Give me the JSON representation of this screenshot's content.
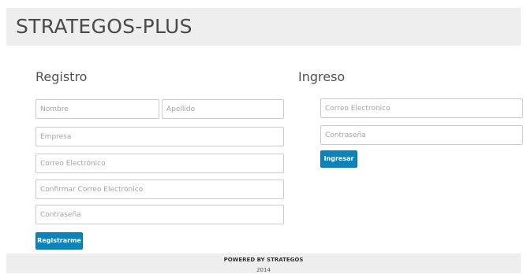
{
  "header": {
    "brand": "STRATEGOS-PLUS"
  },
  "registro": {
    "title": "Registro",
    "fields": {
      "nombre": "Nombre",
      "apellido": "Apellido",
      "empresa": "Empresa",
      "correo": "Correo Electrónico",
      "confirmar_correo": "Confirmar Correo Electrónico",
      "contrasena": "Contraseña"
    },
    "submit_label": "Registrarme"
  },
  "ingreso": {
    "title": "Ingreso",
    "fields": {
      "correo": "Correo Electronico",
      "contrasena": "Contraseña"
    },
    "submit_label": "Ingresar"
  },
  "footer": {
    "powered_by": "POWERED BY STRATEGOS",
    "year": "2014"
  },
  "colors": {
    "header_bg": "#eeeeee",
    "button_bg": "#0d84b9",
    "field_border": "#cccccc"
  }
}
